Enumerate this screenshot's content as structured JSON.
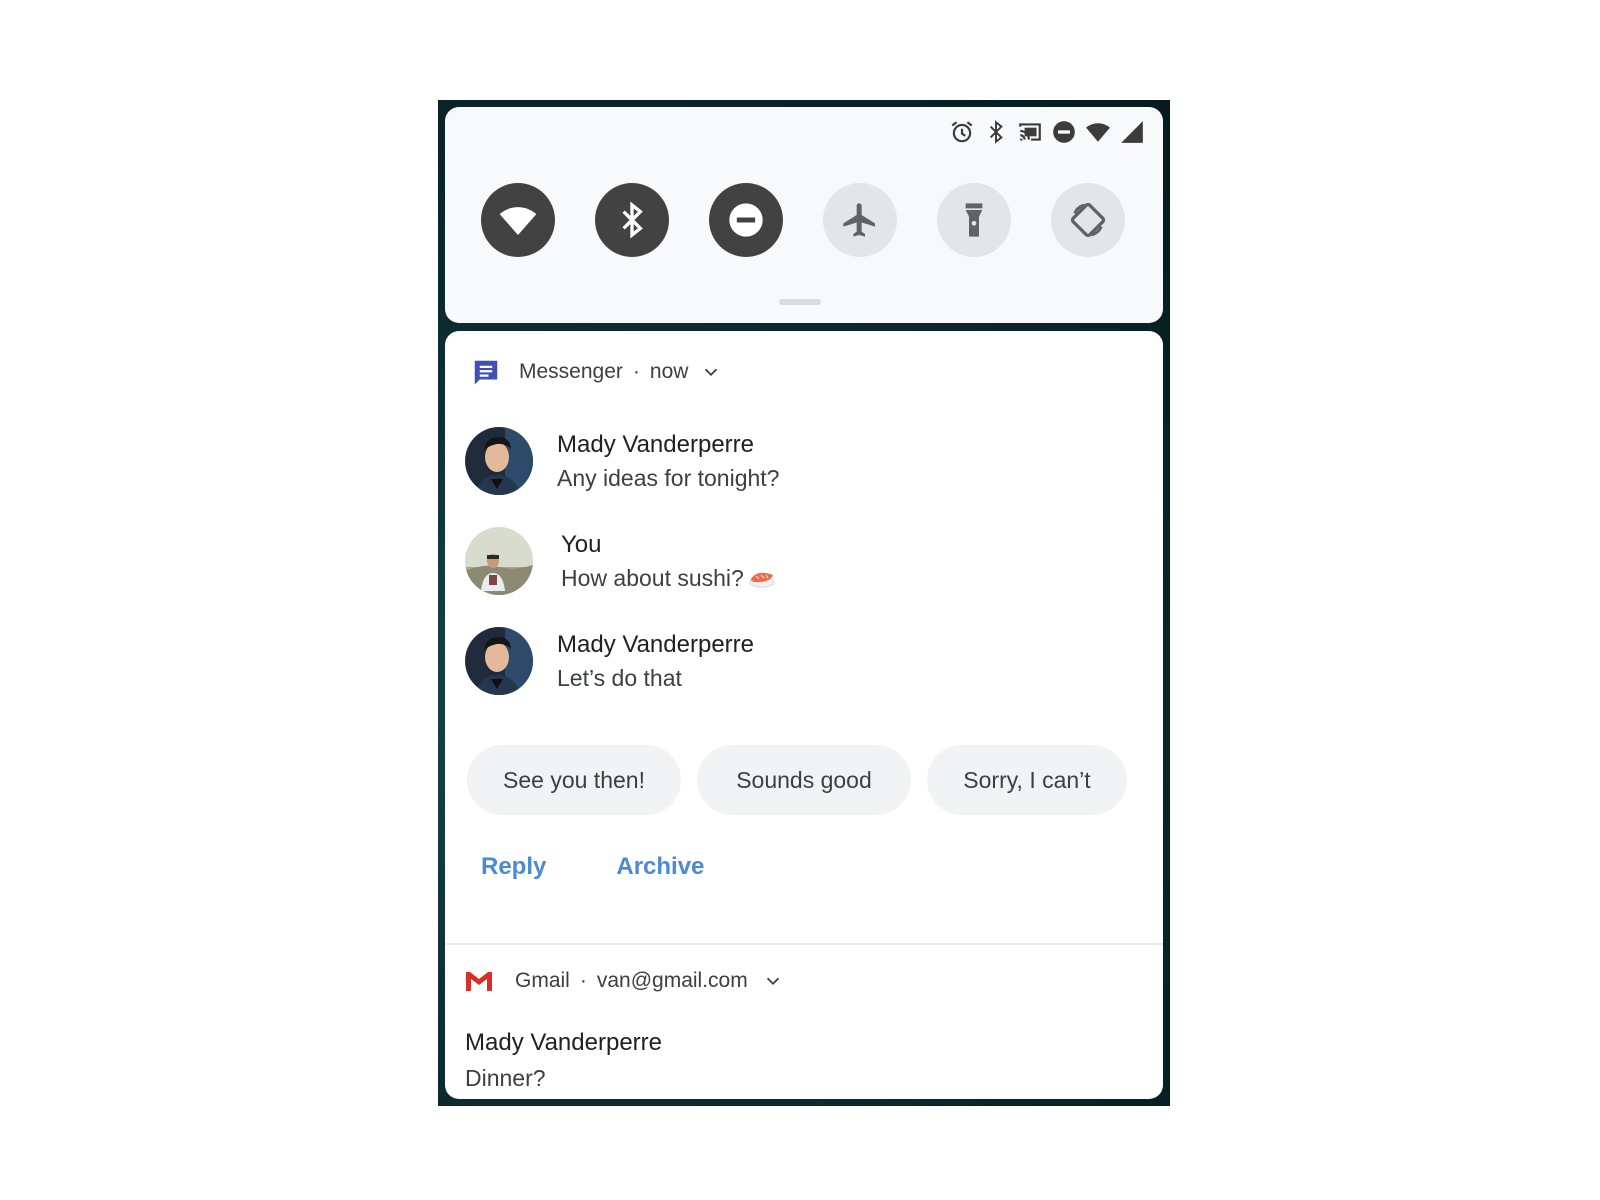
{
  "status_bar": {
    "icons": [
      "alarm-icon",
      "bluetooth-icon",
      "cast-icon",
      "do-not-disturb-icon",
      "wifi-icon",
      "cellular-signal-icon"
    ]
  },
  "quick_settings": {
    "tiles": [
      {
        "icon": "wifi-icon",
        "state": "on"
      },
      {
        "icon": "bluetooth-icon",
        "state": "on"
      },
      {
        "icon": "do-not-disturb-icon",
        "state": "on"
      },
      {
        "icon": "airplane-icon",
        "state": "off"
      },
      {
        "icon": "flashlight-icon",
        "state": "off"
      },
      {
        "icon": "auto-rotate-icon",
        "state": "off"
      }
    ]
  },
  "messenger": {
    "app_name": "Messenger",
    "separator": "·",
    "time": "now",
    "messages": [
      {
        "sender": "Mady Vanderperre",
        "text": "Any ideas for tonight?"
      },
      {
        "sender": "You",
        "text": "How about sushi?",
        "emoji": "sushi-emoji"
      },
      {
        "sender": "Mady Vanderperre",
        "text": "Let’s do that"
      }
    ],
    "smart_replies": [
      "See you then!",
      "Sounds good",
      "Sorry, I can’t"
    ],
    "actions": {
      "reply": "Reply",
      "archive": "Archive"
    }
  },
  "gmail": {
    "app_name": "Gmail",
    "separator": "·",
    "account": "van@gmail.com",
    "sender": "Mady Vanderperre",
    "subject": "Dinner?"
  },
  "colors": {
    "tile_on": "#424242",
    "tile_off": "#e4e5e8",
    "action_blue": "#4a8ad8",
    "messenger_icon": "#3f51b5",
    "gmail_red": "#d93025",
    "chip_bg": "#f1f3f4"
  }
}
